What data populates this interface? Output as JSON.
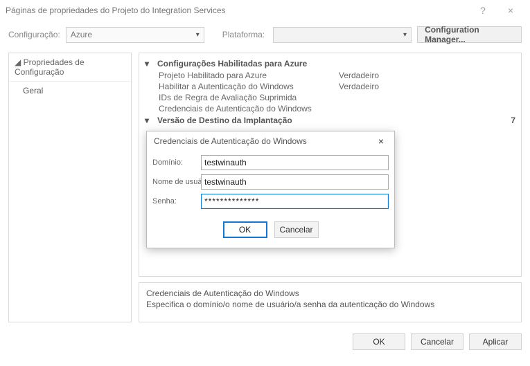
{
  "window": {
    "title": "Páginas de propriedades do Projeto do Integration Services",
    "help_glyph": "?",
    "close_glyph": "×"
  },
  "toolbar": {
    "config_label": "Configuração:",
    "config_value": "Azure",
    "platform_label": "Plataforma:",
    "platform_value": "",
    "config_manager_label": "Configuration Manager..."
  },
  "left_panel": {
    "header": "Propriedades de Configuração",
    "header_prefix": "◢",
    "items": [
      {
        "label": "Geral"
      }
    ]
  },
  "grid": {
    "sections": [
      {
        "expander": "▾",
        "title": "Configurações Habilitadas para Azure",
        "rows": [
          {
            "name": "Projeto Habilitado para Azure",
            "value": "Verdadeiro"
          },
          {
            "name": "Habilitar a Autenticação do Windows",
            "value": "Verdadeiro"
          },
          {
            "name": "IDs de Regra de Avaliação Suprimida",
            "value": ""
          },
          {
            "name": "Credenciais de Autenticação do Windows",
            "value": ""
          }
        ]
      },
      {
        "expander": "▾",
        "title": "Versão de Destino da Implantação",
        "rows": []
      }
    ],
    "trailing_fragment": "7"
  },
  "description": {
    "title": "Credenciais de Autenticação do Windows",
    "body": "Especifica o domínio/o nome de usuário/a senha da autenticação do Windows"
  },
  "footer": {
    "ok": "OK",
    "cancel": "Cancelar",
    "apply": "Aplicar"
  },
  "modal": {
    "title": "Credenciais de Autenticação do Windows",
    "close_glyph": "×",
    "fields": {
      "domain_label": "Domínio:",
      "domain_value": "testwinauth",
      "user_label": "Nome de usuá",
      "user_value": "testwinauth",
      "password_label": "Senha:",
      "password_value": "**************"
    },
    "ok": "OK",
    "cancel": "Cancelar"
  }
}
